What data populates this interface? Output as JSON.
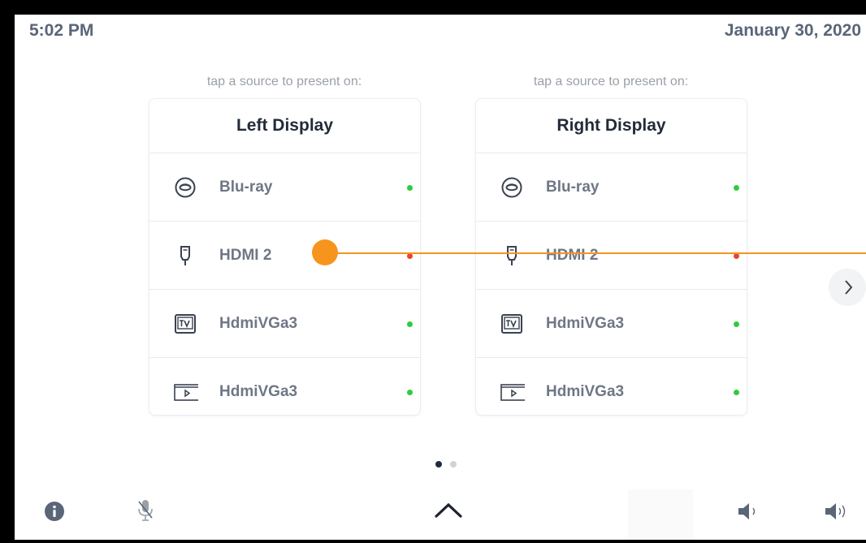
{
  "header": {
    "time": "5:02 PM",
    "date": "January 30, 2020"
  },
  "panels": [
    {
      "prompt": "tap a source to present on:",
      "title": "Left Display",
      "sources": [
        {
          "icon": "bluray-disc-icon",
          "label": "Blu-ray",
          "status_color": "#2ecc40"
        },
        {
          "icon": "hdmi-plug-icon",
          "label": "HDMI 2",
          "status_color": "#e8452c"
        },
        {
          "icon": "tv-icon",
          "label": "HdmiVGa3",
          "status_color": "#2ecc40"
        },
        {
          "icon": "video-player-icon",
          "label": "HdmiVGa3",
          "status_color": "#2ecc40"
        }
      ]
    },
    {
      "prompt": "tap a source to present on:",
      "title": "Right Display",
      "sources": [
        {
          "icon": "bluray-disc-icon",
          "label": "Blu-ray",
          "status_color": "#2ecc40"
        },
        {
          "icon": "hdmi-plug-icon",
          "label": "HDMI 2",
          "status_color": "#e8452c"
        },
        {
          "icon": "tv-icon",
          "label": "HdmiVGa3",
          "status_color": "#2ecc40"
        },
        {
          "icon": "video-player-icon",
          "label": "HdmiVGa3",
          "status_color": "#2ecc40"
        }
      ]
    }
  ],
  "pager": {
    "current_page": 1,
    "total_pages": 2,
    "active_color": "#1f2a44",
    "inactive_color": "#cfd3d9"
  },
  "bottom_bar": {
    "icons": [
      "info-icon",
      "microphone-muted-icon",
      "chevron-up-icon",
      "volume-down-icon",
      "volume-up-icon"
    ]
  },
  "colors": {
    "gesture_overlay": "#f7941d",
    "text_primary": "#222b38",
    "text_secondary": "#6f7786"
  }
}
